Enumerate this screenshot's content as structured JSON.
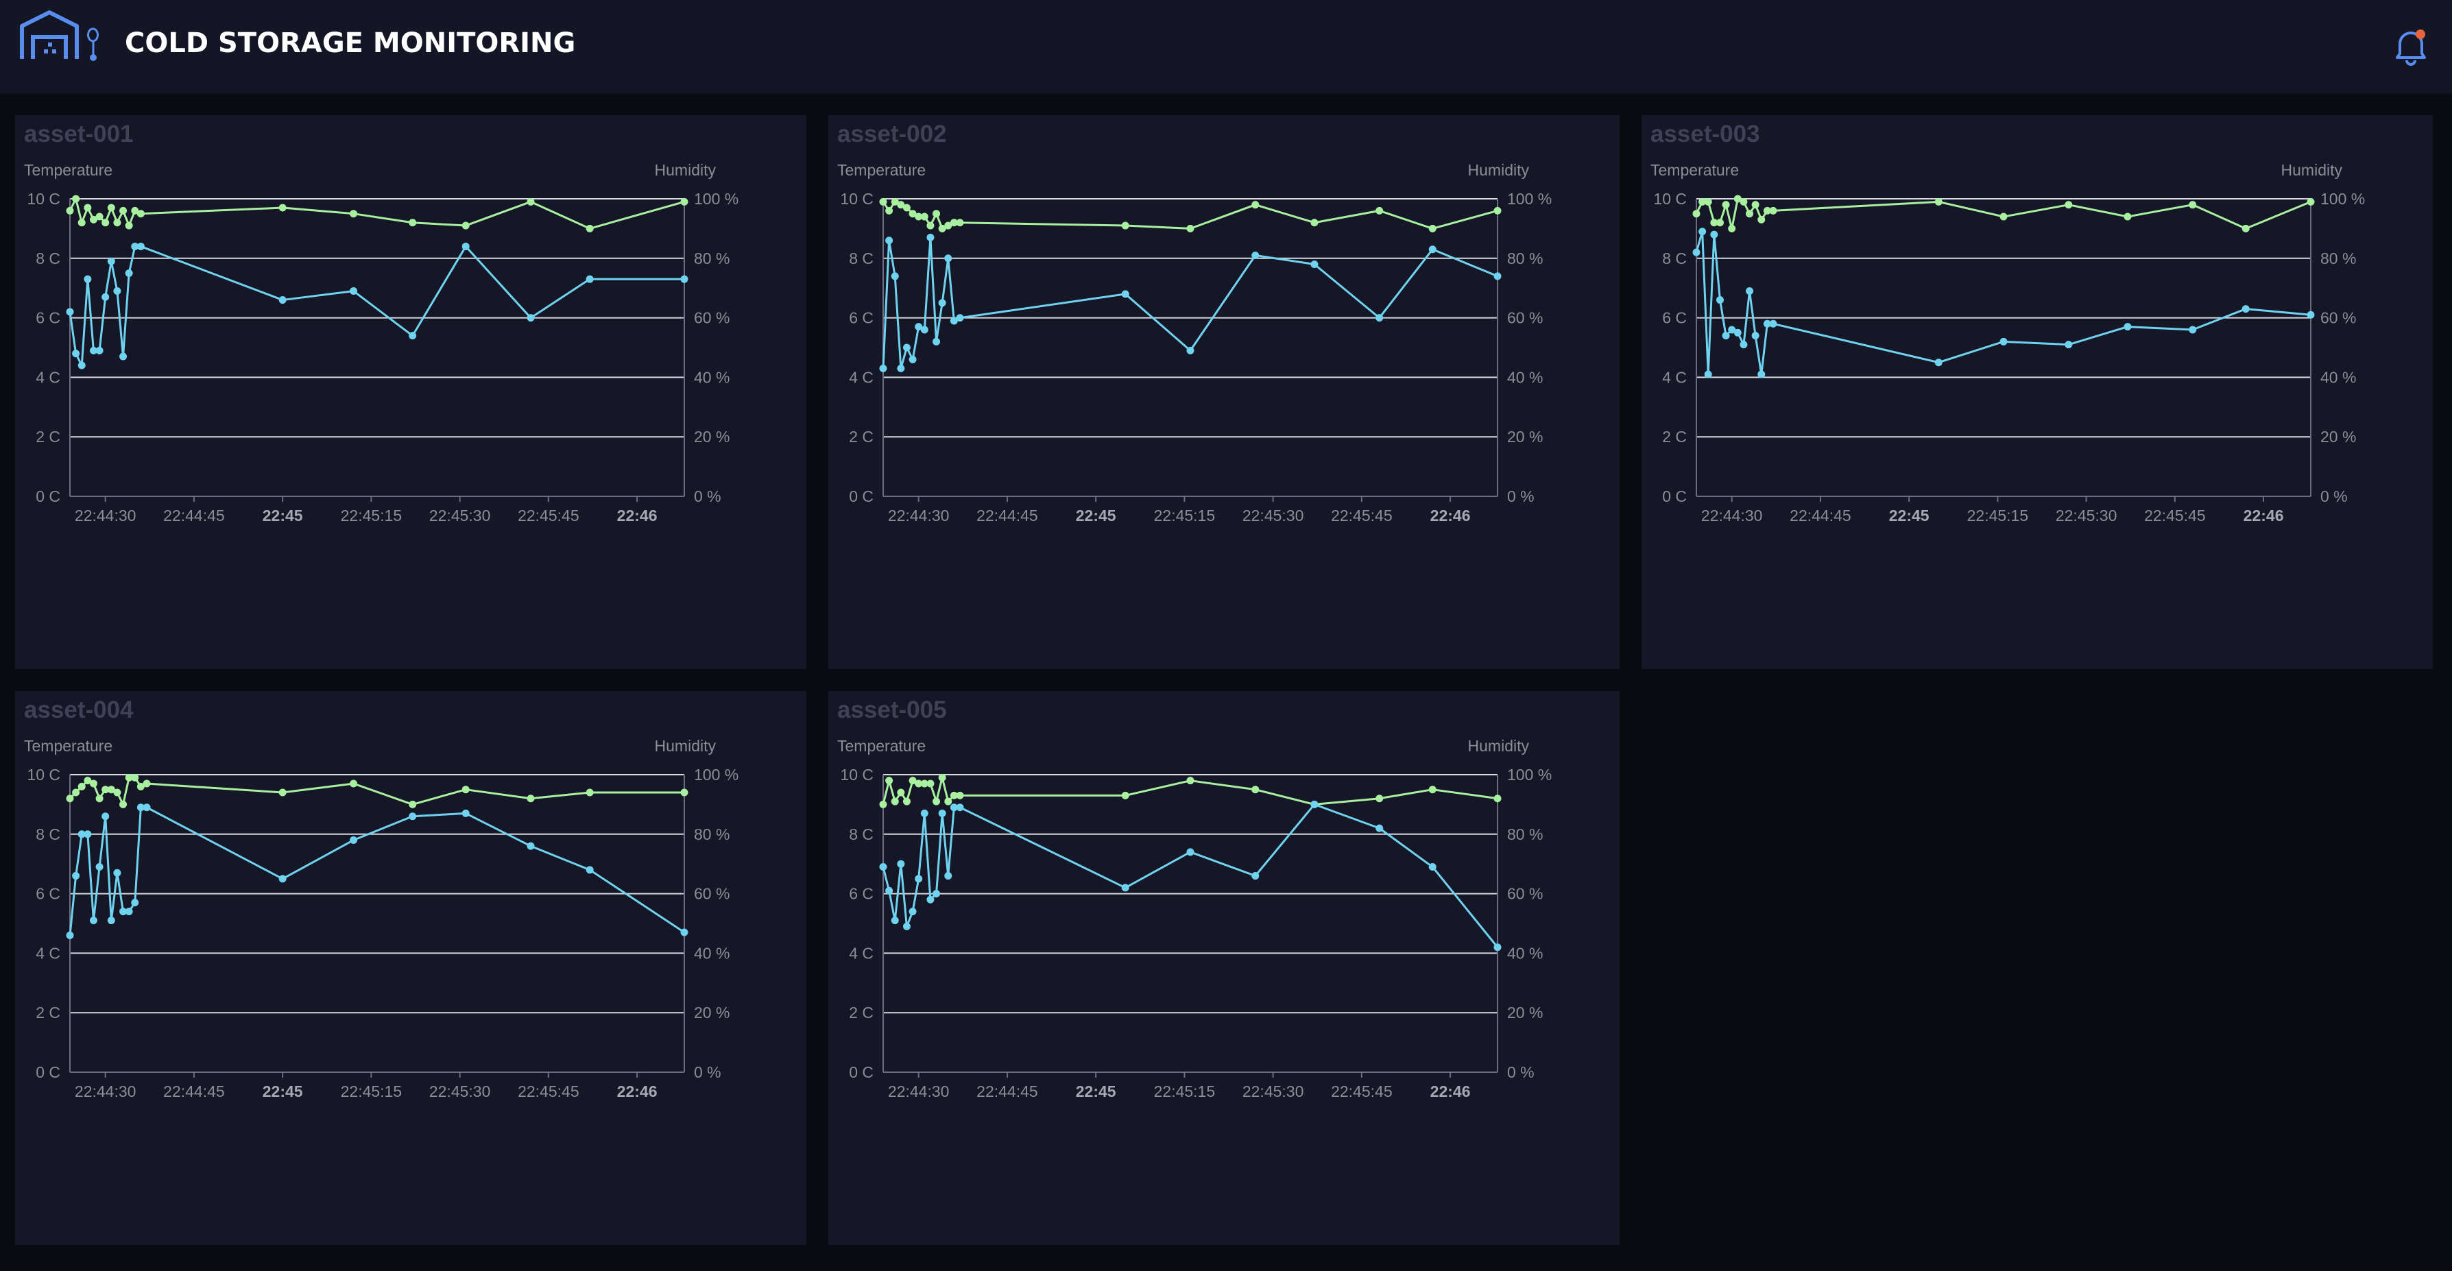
{
  "header": {
    "title": "COLD STORAGE MONITORING",
    "logo_icon": "warehouse-thermometer-icon",
    "notification_icon": "bell-icon",
    "notification_dot_color": "#e8643c",
    "accent_color": "#5a8df0"
  },
  "colors": {
    "temperature": "#6fd3f0",
    "humidity": "#a8f0a0"
  },
  "shared_axes": {
    "left_label": "Temperature",
    "right_label": "Humidity",
    "left_ticks": [
      "0 C",
      "2 C",
      "4 C",
      "6 C",
      "8 C",
      "10 C"
    ],
    "right_ticks": [
      "0 %",
      "20 %",
      "40 %",
      "60 %",
      "80 %",
      "100 %"
    ],
    "x_ticks": [
      {
        "label": "22:44:30",
        "bold": false
      },
      {
        "label": "22:44:45",
        "bold": false
      },
      {
        "label": "22:45",
        "bold": true
      },
      {
        "label": "22:45:15",
        "bold": false
      },
      {
        "label": "22:45:30",
        "bold": false
      },
      {
        "label": "22:45:45",
        "bold": false
      },
      {
        "label": "22:46",
        "bold": true
      }
    ]
  },
  "chart_data": [
    {
      "type": "line",
      "title": "asset-001",
      "ylabel": "Temperature",
      "y2label": "Humidity",
      "ylim": [
        0,
        10
      ],
      "y2lim": [
        0,
        100
      ],
      "x_range": [
        "22:44:24",
        "22:46:08"
      ],
      "grid": true,
      "series": [
        {
          "name": "Temperature",
          "axis": "left",
          "x": [
            "22:44:24",
            "22:44:25",
            "22:44:26",
            "22:44:27",
            "22:44:28",
            "22:44:29",
            "22:44:30",
            "22:44:31",
            "22:44:32",
            "22:44:33",
            "22:44:34",
            "22:44:35",
            "22:44:36",
            "22:45:00",
            "22:45:12",
            "22:45:22",
            "22:45:31",
            "22:45:42",
            "22:45:52",
            "22:46:08"
          ],
          "values": [
            6.2,
            4.8,
            4.4,
            7.3,
            4.9,
            4.9,
            6.7,
            7.9,
            6.9,
            4.7,
            7.5,
            8.4,
            8.4,
            6.6,
            6.9,
            5.4,
            8.4,
            6.0,
            7.3,
            7.3
          ]
        },
        {
          "name": "Humidity",
          "axis": "right",
          "x": [
            "22:44:24",
            "22:44:25",
            "22:44:26",
            "22:44:27",
            "22:44:28",
            "22:44:29",
            "22:44:30",
            "22:44:31",
            "22:44:32",
            "22:44:33",
            "22:44:34",
            "22:44:35",
            "22:44:36",
            "22:45:00",
            "22:45:12",
            "22:45:22",
            "22:45:31",
            "22:45:42",
            "22:45:52",
            "22:46:08"
          ],
          "values": [
            96,
            100,
            92,
            97,
            93,
            94,
            92,
            97,
            92,
            96,
            91,
            96,
            95,
            97,
            95,
            92,
            91,
            99,
            90,
            99
          ]
        }
      ]
    },
    {
      "type": "line",
      "title": "asset-002",
      "ylabel": "Temperature",
      "y2label": "Humidity",
      "ylim": [
        0,
        10
      ],
      "y2lim": [
        0,
        100
      ],
      "x_range": [
        "22:44:24",
        "22:46:08"
      ],
      "grid": true,
      "series": [
        {
          "name": "Temperature",
          "axis": "left",
          "x": [
            "22:44:24",
            "22:44:25",
            "22:44:26",
            "22:44:27",
            "22:44:28",
            "22:44:29",
            "22:44:30",
            "22:44:31",
            "22:44:32",
            "22:44:33",
            "22:44:34",
            "22:44:35",
            "22:44:36",
            "22:44:37",
            "22:45:05",
            "22:45:16",
            "22:45:27",
            "22:45:37",
            "22:45:48",
            "22:45:57",
            "22:46:08"
          ],
          "values": [
            4.3,
            8.6,
            7.4,
            4.3,
            5.0,
            4.6,
            5.7,
            5.6,
            8.7,
            5.2,
            6.5,
            8.0,
            5.9,
            6.0,
            6.8,
            4.9,
            8.1,
            7.8,
            6.0,
            8.3,
            7.4
          ]
        },
        {
          "name": "Humidity",
          "axis": "right",
          "x": [
            "22:44:24",
            "22:44:25",
            "22:44:26",
            "22:44:27",
            "22:44:28",
            "22:44:29",
            "22:44:30",
            "22:44:31",
            "22:44:32",
            "22:44:33",
            "22:44:34",
            "22:44:35",
            "22:44:36",
            "22:44:37",
            "22:45:05",
            "22:45:16",
            "22:45:27",
            "22:45:37",
            "22:45:48",
            "22:45:57",
            "22:46:08"
          ],
          "values": [
            99,
            96,
            99,
            98,
            97,
            95,
            94,
            94,
            91,
            95,
            90,
            91,
            92,
            92,
            91,
            90,
            98,
            92,
            96,
            90,
            96
          ]
        }
      ]
    },
    {
      "type": "line",
      "title": "asset-003",
      "ylabel": "Temperature",
      "y2label": "Humidity",
      "ylim": [
        0,
        10
      ],
      "y2lim": [
        0,
        100
      ],
      "x_range": [
        "22:44:24",
        "22:46:08"
      ],
      "grid": true,
      "series": [
        {
          "name": "Temperature",
          "axis": "left",
          "x": [
            "22:44:24",
            "22:44:25",
            "22:44:26",
            "22:44:27",
            "22:44:28",
            "22:44:29",
            "22:44:30",
            "22:44:31",
            "22:44:32",
            "22:44:33",
            "22:44:34",
            "22:44:35",
            "22:44:36",
            "22:44:37",
            "22:45:05",
            "22:45:16",
            "22:45:27",
            "22:45:37",
            "22:45:48",
            "22:45:57",
            "22:46:08"
          ],
          "values": [
            8.2,
            8.9,
            4.1,
            8.8,
            6.6,
            5.4,
            5.6,
            5.5,
            5.1,
            6.9,
            5.4,
            4.1,
            5.8,
            5.8,
            4.5,
            5.2,
            5.1,
            5.7,
            5.6,
            6.3,
            6.1
          ]
        },
        {
          "name": "Humidity",
          "axis": "right",
          "x": [
            "22:44:24",
            "22:44:25",
            "22:44:26",
            "22:44:27",
            "22:44:28",
            "22:44:29",
            "22:44:30",
            "22:44:31",
            "22:44:32",
            "22:44:33",
            "22:44:34",
            "22:44:35",
            "22:44:36",
            "22:44:37",
            "22:45:05",
            "22:45:16",
            "22:45:27",
            "22:45:37",
            "22:45:48",
            "22:45:57",
            "22:46:08"
          ],
          "values": [
            95,
            99,
            99,
            92,
            92,
            98,
            90,
            100,
            99,
            95,
            98,
            93,
            96,
            96,
            99,
            94,
            98,
            94,
            98,
            90,
            99
          ]
        }
      ]
    },
    {
      "type": "line",
      "title": "asset-004",
      "ylabel": "Temperature",
      "y2label": "Humidity",
      "ylim": [
        0,
        10
      ],
      "y2lim": [
        0,
        100
      ],
      "x_range": [
        "22:44:24",
        "22:46:08"
      ],
      "grid": true,
      "series": [
        {
          "name": "Temperature",
          "axis": "left",
          "x": [
            "22:44:24",
            "22:44:25",
            "22:44:26",
            "22:44:27",
            "22:44:28",
            "22:44:29",
            "22:44:30",
            "22:44:31",
            "22:44:32",
            "22:44:33",
            "22:44:34",
            "22:44:35",
            "22:44:36",
            "22:44:37",
            "22:45:00",
            "22:45:12",
            "22:45:22",
            "22:45:31",
            "22:45:42",
            "22:45:52",
            "22:46:08"
          ],
          "values": [
            4.6,
            6.6,
            8.0,
            8.0,
            5.1,
            6.9,
            8.6,
            5.1,
            6.7,
            5.4,
            5.4,
            5.7,
            8.9,
            8.9,
            6.5,
            7.8,
            8.6,
            8.7,
            7.6,
            6.8,
            4.7
          ]
        },
        {
          "name": "Humidity",
          "axis": "right",
          "x": [
            "22:44:24",
            "22:44:25",
            "22:44:26",
            "22:44:27",
            "22:44:28",
            "22:44:29",
            "22:44:30",
            "22:44:31",
            "22:44:32",
            "22:44:33",
            "22:44:34",
            "22:44:35",
            "22:44:36",
            "22:44:37",
            "22:45:00",
            "22:45:12",
            "22:45:22",
            "22:45:31",
            "22:45:42",
            "22:45:52",
            "22:46:08"
          ],
          "values": [
            92,
            94,
            96,
            98,
            97,
            92,
            95,
            95,
            94,
            90,
            99,
            99,
            96,
            97,
            94,
            97,
            90,
            95,
            92,
            94,
            94
          ]
        }
      ]
    },
    {
      "type": "line",
      "title": "asset-005",
      "ylabel": "Temperature",
      "y2label": "Humidity",
      "ylim": [
        0,
        10
      ],
      "y2lim": [
        0,
        100
      ],
      "x_range": [
        "22:44:24",
        "22:46:08"
      ],
      "grid": true,
      "series": [
        {
          "name": "Temperature",
          "axis": "left",
          "x": [
            "22:44:24",
            "22:44:25",
            "22:44:26",
            "22:44:27",
            "22:44:28",
            "22:44:29",
            "22:44:30",
            "22:44:31",
            "22:44:32",
            "22:44:33",
            "22:44:34",
            "22:44:35",
            "22:44:36",
            "22:44:37",
            "22:45:05",
            "22:45:16",
            "22:45:27",
            "22:45:37",
            "22:45:48",
            "22:45:57",
            "22:46:08"
          ],
          "values": [
            6.9,
            6.1,
            5.1,
            7.0,
            4.9,
            5.4,
            6.5,
            8.7,
            5.8,
            6.0,
            8.7,
            6.6,
            8.9,
            8.9,
            6.2,
            7.4,
            6.6,
            9.0,
            8.2,
            6.9,
            4.2
          ]
        },
        {
          "name": "Humidity",
          "axis": "right",
          "x": [
            "22:44:24",
            "22:44:25",
            "22:44:26",
            "22:44:27",
            "22:44:28",
            "22:44:29",
            "22:44:30",
            "22:44:31",
            "22:44:32",
            "22:44:33",
            "22:44:34",
            "22:44:35",
            "22:44:36",
            "22:44:37",
            "22:45:05",
            "22:45:16",
            "22:45:27",
            "22:45:37",
            "22:45:48",
            "22:45:57",
            "22:46:08"
          ],
          "values": [
            90,
            98,
            91,
            94,
            91,
            98,
            97,
            97,
            97,
            91,
            99,
            91,
            93,
            93,
            93,
            98,
            95,
            90,
            92,
            95,
            92
          ]
        }
      ]
    }
  ]
}
